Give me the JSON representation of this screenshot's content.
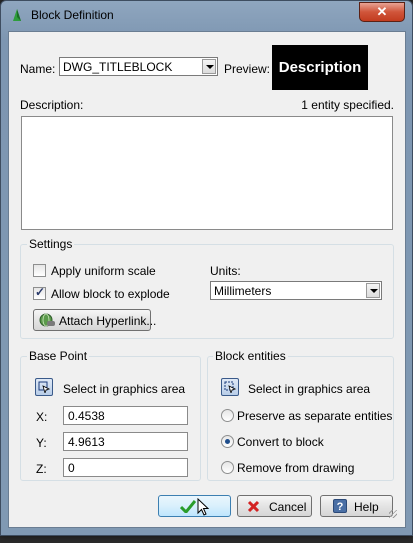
{
  "window": {
    "title": "Block Definition",
    "close_label": "✕"
  },
  "name_row": {
    "label": "Name:",
    "value": "DWG_TITLEBLOCK",
    "preview_label": "Preview:",
    "preview_text": "Description"
  },
  "description": {
    "label": "Description:",
    "entity_count": "1 entity specified.",
    "value": ""
  },
  "settings": {
    "title": "Settings",
    "uniform_scale_label": "Apply uniform scale",
    "uniform_scale_checked": false,
    "explode_label": "Allow block to explode",
    "explode_checked": true,
    "units_label": "Units:",
    "units_value": "Millimeters",
    "hyperlink_label": "Attach Hyperlink..."
  },
  "base_point": {
    "title": "Base Point",
    "select_label": "Select in graphics area",
    "x_label": "X:",
    "x_value": "0.4538",
    "y_label": "Y:",
    "y_value": "4.9613",
    "z_label": "Z:",
    "z_value": "0"
  },
  "block_entities": {
    "title": "Block entities",
    "select_label": "Select in graphics area",
    "options": [
      {
        "label": "Preserve as separate entities",
        "selected": false
      },
      {
        "label": "Convert to block",
        "selected": true
      },
      {
        "label": "Remove from drawing",
        "selected": false
      }
    ]
  },
  "buttons": {
    "ok_label": "",
    "cancel_label": "Cancel",
    "help_label": "Help"
  },
  "colors": {
    "ok_check": "#2a9d2a",
    "cancel_x": "#d32222",
    "help_icon": "#4a6fa5"
  }
}
